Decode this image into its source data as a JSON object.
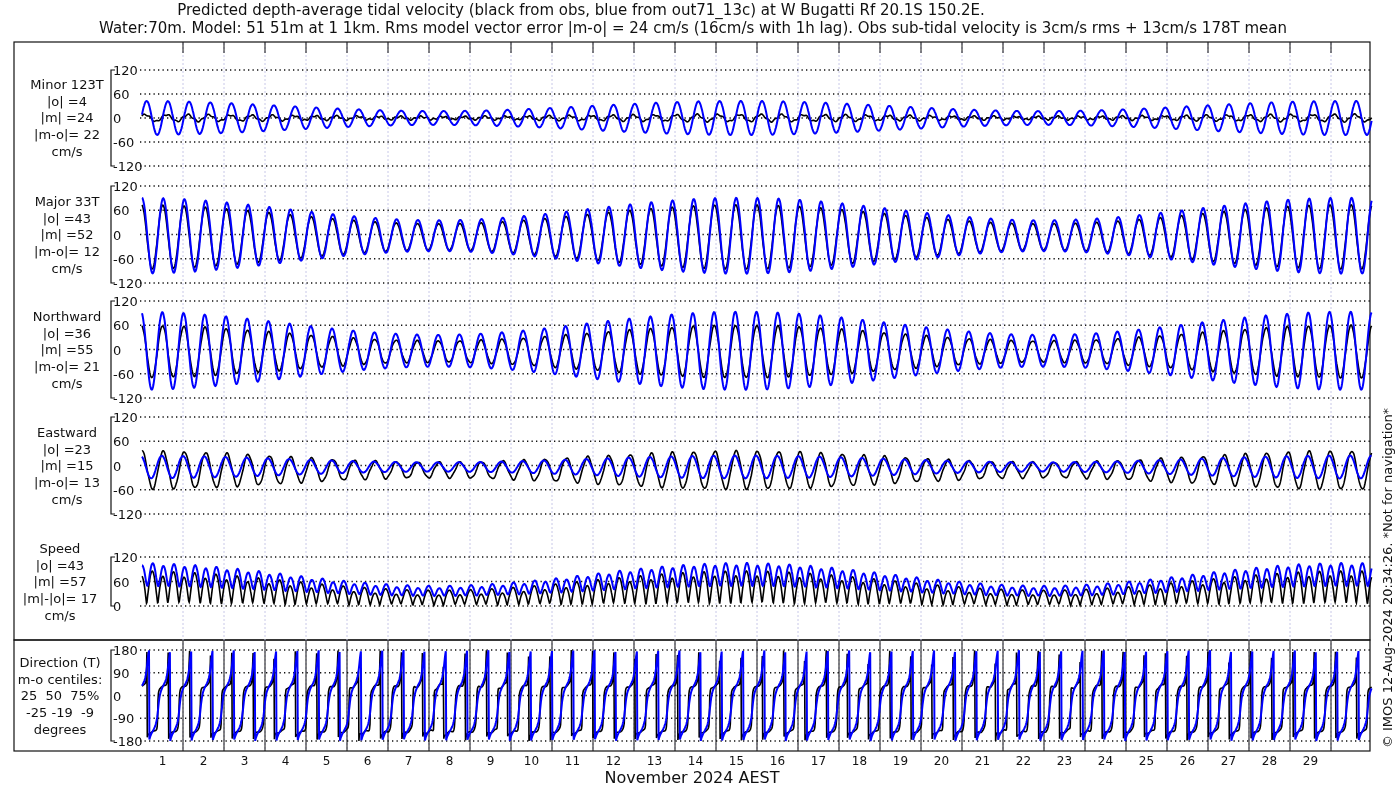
{
  "title_lines": [
    "Predicted depth-average tidal velocity (black from obs, blue from out71_13c) at W Bugatti Rf 20.1S 150.2E.",
    "Water:70m. Model: 51 51m at 1 1km. Rms model vector error |m-o| = 24 cm/s (16cm/s with 1h lag). Obs sub-tidal velocity is 3cm/s rms + 13cm/s 178T mean"
  ],
  "panels": [
    {
      "kind": "minor",
      "label_lines": [
        "Minor 123T",
        "|o| =4",
        "|m| =24",
        "|m-o|= 22",
        "cm/s"
      ],
      "yticks": [
        "120",
        "60",
        "0",
        "-60",
        "-120"
      ]
    },
    {
      "kind": "major",
      "label_lines": [
        "Major 33T",
        "|o| =43",
        "|m| =52",
        "|m-o|= 12",
        "cm/s"
      ],
      "yticks": [
        "120",
        "60",
        "0",
        "-60",
        "-120"
      ]
    },
    {
      "kind": "north",
      "label_lines": [
        "Northward",
        "|o| =36",
        "|m| =55",
        "|m-o|= 21",
        "cm/s"
      ],
      "yticks": [
        "120",
        "60",
        "0",
        "-60",
        "-120"
      ]
    },
    {
      "kind": "east",
      "label_lines": [
        "Eastward",
        "|o| =23",
        "|m| =15",
        "|m-o|= 13",
        "cm/s"
      ],
      "yticks": [
        "120",
        "60",
        "0",
        "-60",
        "-120"
      ]
    },
    {
      "kind": "speed",
      "label_lines": [
        "Speed",
        "|o| =43",
        "|m| =57",
        "|m|-|o|= 17",
        "cm/s"
      ],
      "yticks": [
        "120",
        "60",
        "0"
      ]
    },
    {
      "kind": "direction",
      "label_lines": [
        "Direction (T)",
        "m-o centiles:",
        "25  50  75%",
        "-25 -19  -9",
        "degrees"
      ],
      "yticks": [
        "180",
        "90",
        "0",
        "-90",
        "-180"
      ]
    }
  ],
  "day_labels": [
    "1",
    "2",
    "3",
    "4",
    "5",
    "6",
    "7",
    "8",
    "9",
    "10",
    "11",
    "12",
    "13",
    "14",
    "15",
    "16",
    "17",
    "18",
    "19",
    "20",
    "21",
    "22",
    "23",
    "24",
    "25",
    "26",
    "27",
    "28",
    "29"
  ],
  "xlabel": "November 2024 AEST",
  "credit": "© IMOS 12-Aug-2024 20:34:26. *Not for navigation*"
}
